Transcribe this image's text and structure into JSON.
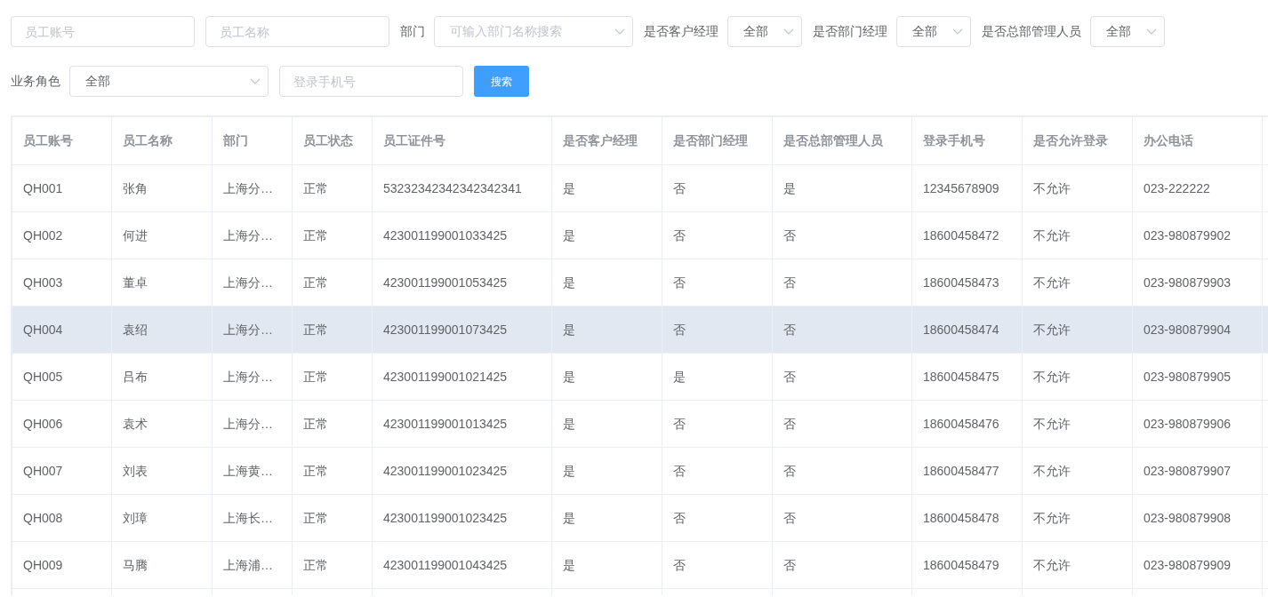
{
  "filters": [
    {
      "kind": "input",
      "placeholder": "员工账号"
    },
    {
      "kind": "input",
      "placeholder": "员工名称"
    },
    {
      "kind": "label",
      "text": "部门"
    },
    {
      "kind": "select",
      "placeholder": "可输入部门名称搜索"
    },
    {
      "kind": "label",
      "text": "是否客户经理"
    },
    {
      "kind": "select",
      "value": "全部"
    },
    {
      "kind": "label",
      "text": "是否部门经理"
    },
    {
      "kind": "select",
      "value": "全部"
    },
    {
      "kind": "label",
      "text": "是否总部管理人员"
    },
    {
      "kind": "select",
      "value": "全部"
    },
    {
      "kind": "break"
    },
    {
      "kind": "label",
      "text": "业务角色"
    },
    {
      "kind": "select",
      "value": "全部"
    },
    {
      "kind": "input",
      "placeholder": "登录手机号"
    },
    {
      "kind": "button",
      "text": "搜索"
    }
  ],
  "table": {
    "columns": [
      "员工账号",
      "员工名称",
      "部门",
      "员工状态",
      "员工证件号",
      "是否客户经理",
      "是否部门经理",
      "是否总部管理人员",
      "登录手机号",
      "是否允许登录",
      "办公电话"
    ],
    "rows": [
      {
        "highlighted": false,
        "cells": [
          "QH001",
          "张角",
          "上海分…",
          "正常",
          "53232342342342342341",
          "是",
          "否",
          "是",
          "12345678909",
          "不允许",
          "023-222222"
        ]
      },
      {
        "highlighted": false,
        "cells": [
          "QH002",
          "何进",
          "上海分…",
          "正常",
          "423001199001033425",
          "是",
          "否",
          "否",
          "18600458472",
          "不允许",
          "023-980879902"
        ]
      },
      {
        "highlighted": false,
        "cells": [
          "QH003",
          "董卓",
          "上海分…",
          "正常",
          "423001199001053425",
          "是",
          "否",
          "否",
          "18600458473",
          "不允许",
          "023-980879903"
        ]
      },
      {
        "highlighted": true,
        "cells": [
          "QH004",
          "袁绍",
          "上海分…",
          "正常",
          "423001199001073425",
          "是",
          "否",
          "否",
          "18600458474",
          "不允许",
          "023-980879904"
        ]
      },
      {
        "highlighted": false,
        "cells": [
          "QH005",
          "吕布",
          "上海分…",
          "正常",
          "423001199001021425",
          "是",
          "是",
          "否",
          "18600458475",
          "不允许",
          "023-980879905"
        ]
      },
      {
        "highlighted": false,
        "cells": [
          "QH006",
          "袁术",
          "上海分…",
          "正常",
          "423001199001013425",
          "是",
          "否",
          "否",
          "18600458476",
          "不允许",
          "023-980879906"
        ]
      },
      {
        "highlighted": false,
        "cells": [
          "QH007",
          "刘表",
          "上海黄…",
          "正常",
          "423001199001023425",
          "是",
          "否",
          "否",
          "18600458477",
          "不允许",
          "023-980879907"
        ]
      },
      {
        "highlighted": false,
        "cells": [
          "QH008",
          "刘璋",
          "上海长…",
          "正常",
          "423001199001023425",
          "是",
          "否",
          "否",
          "18600458478",
          "不允许",
          "023-980879908"
        ]
      },
      {
        "highlighted": false,
        "cells": [
          "QH009",
          "马腾",
          "上海浦…",
          "正常",
          "423001199001043425",
          "是",
          "否",
          "否",
          "18600458479",
          "不允许",
          "023-980879909"
        ]
      }
    ]
  }
}
